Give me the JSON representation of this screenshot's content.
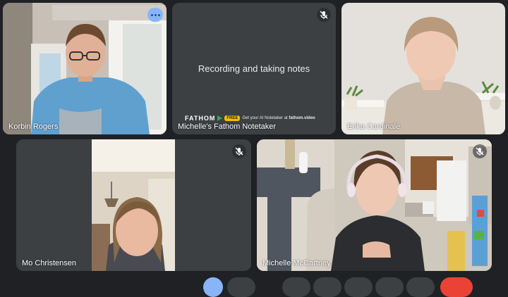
{
  "tiles": {
    "t1": {
      "name": "Korbin Rogers"
    },
    "t2": {
      "name": "Michelle's Fathom Notetaker",
      "message": "Recording and taking notes",
      "brand": "FATHOM",
      "badge": "FREE",
      "promo_prefix": "Get your AI Notetaker at ",
      "promo_link": "fathom.video"
    },
    "t3": {
      "name": "Erika Cardinale"
    },
    "t4": {
      "name": "Mo Christensen"
    },
    "t5": {
      "name": "Michelle McCartney"
    }
  },
  "colors": {
    "background": "#202124",
    "tile": "#3c4043",
    "accent": "#8ab4f8",
    "end_call": "#ea4335",
    "badge": "#fbbc04"
  },
  "icons": {
    "mic_off": "mic-off-icon",
    "more": "more-options-icon"
  }
}
